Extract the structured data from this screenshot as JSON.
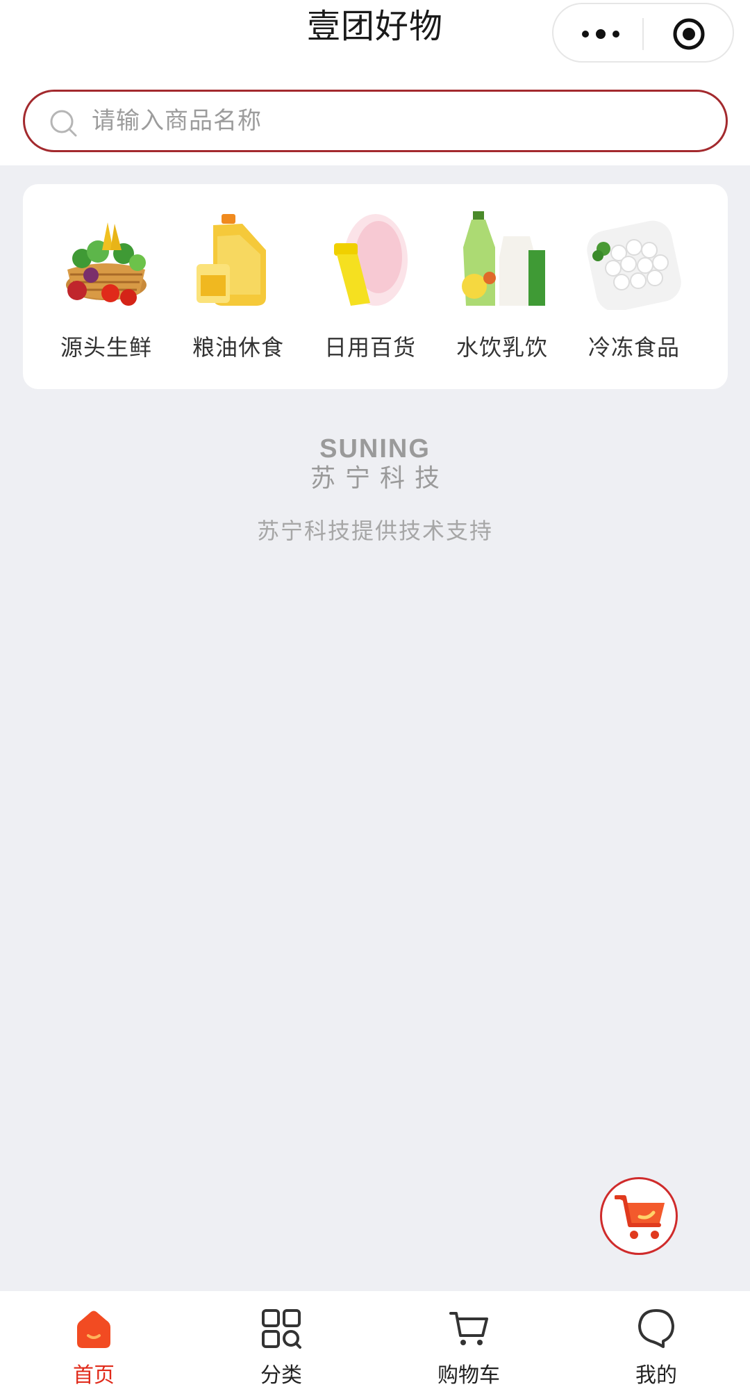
{
  "header": {
    "title": "壹团好物",
    "capsule": {
      "more_icon": "more-dots-icon",
      "close_icon": "target-icon"
    }
  },
  "search": {
    "placeholder": "请输入商品名称",
    "icon": "search-icon"
  },
  "categories": [
    {
      "label": "源头生鲜",
      "icon": "fresh-produce-basket"
    },
    {
      "label": "粮油休食",
      "icon": "cooking-oil-bottle"
    },
    {
      "label": "日用百货",
      "icon": "daily-goods-bottle"
    },
    {
      "label": "水饮乳饮",
      "icon": "juice-bottles"
    },
    {
      "label": "冷冻食品",
      "icon": "frozen-balls-plate"
    }
  ],
  "branding": {
    "logo_en": "SUNING",
    "logo_cn": "苏宁科技",
    "support_text": "苏宁科技提供技术支持"
  },
  "tabs": [
    {
      "label": "首页",
      "icon": "home-icon",
      "active": true
    },
    {
      "label": "分类",
      "icon": "category-grid-icon",
      "active": false
    },
    {
      "label": "购物车",
      "icon": "cart-icon",
      "active": false
    },
    {
      "label": "我的",
      "icon": "profile-icon",
      "active": false
    }
  ],
  "colors": {
    "accent": "#e02a1a",
    "search_border": "#a32a2e",
    "background": "#eeeff3"
  }
}
